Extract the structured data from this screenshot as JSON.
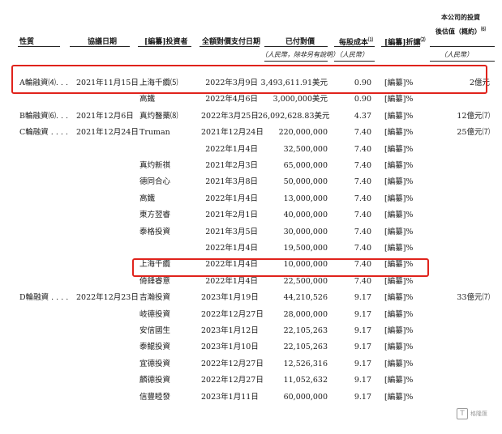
{
  "headers": {
    "nature": "性質",
    "agreement_date": "協議日期",
    "investor": "[編纂]投資者",
    "payment_date": "全額對價支付日期",
    "consideration": "已付對價",
    "consideration_unit": "（人民幣，除非另有說明）",
    "cost_per_share": "每股成本",
    "cost_per_share_note": "⑴",
    "cost_per_share_unit": "（人民幣）",
    "discount": "[編纂]折讓",
    "discount_note": "⑵",
    "post_value_line1": "本公司的投資",
    "post_value_line2": "後估值（概約）",
    "post_value_note": "⑹",
    "post_value_unit": "（人民幣）"
  },
  "rows": [
    {
      "nature": "A輪融資⑷. . .",
      "agreement_date": "2021年11月15日",
      "investor": "上海千纜⑸",
      "payment_date": "2022年3月9日",
      "consideration": "3,493,611.91美元",
      "cost": "0.90",
      "discount": "[編纂]%",
      "valuation": "2億元"
    },
    {
      "nature": "",
      "agreement_date": "",
      "investor": "高鐵",
      "payment_date": "2022年4月6日",
      "consideration": "3,000,000美元",
      "cost": "0.90",
      "discount": "[編纂]%",
      "valuation": ""
    },
    {
      "nature": "B輪融資⑹. . .",
      "agreement_date": "2021年12月6日",
      "investor": "真灼醫藥⑻",
      "payment_date": "2022年3月25日",
      "consideration": "26,092,628.83美元",
      "cost": "4.37",
      "discount": "[編纂]%",
      "valuation": "12億元⑺"
    },
    {
      "nature": "C輪融資 . . . .",
      "agreement_date": "2021年12月24日",
      "investor": "Truman",
      "payment_date": "2021年12月24日",
      "consideration": "220,000,000",
      "cost": "7.40",
      "discount": "[編纂]%",
      "valuation": "25億元⑺"
    },
    {
      "nature": "",
      "agreement_date": "",
      "investor": "",
      "payment_date": "2022年1月4日",
      "consideration": "32,500,000",
      "cost": "7.40",
      "discount": "[編纂]%",
      "valuation": ""
    },
    {
      "nature": "",
      "agreement_date": "",
      "investor": "真灼新祺",
      "payment_date": "2021年2月3日",
      "consideration": "65,000,000",
      "cost": "7.40",
      "discount": "[編纂]%",
      "valuation": ""
    },
    {
      "nature": "",
      "agreement_date": "",
      "investor": "德同合心",
      "payment_date": "2021年3月8日",
      "consideration": "50,000,000",
      "cost": "7.40",
      "discount": "[編纂]%",
      "valuation": ""
    },
    {
      "nature": "",
      "agreement_date": "",
      "investor": "高鐵",
      "payment_date": "2022年1月4日",
      "consideration": "13,000,000",
      "cost": "7.40",
      "discount": "[編纂]%",
      "valuation": ""
    },
    {
      "nature": "",
      "agreement_date": "",
      "investor": "東方翌睿",
      "payment_date": "2021年2月1日",
      "consideration": "40,000,000",
      "cost": "7.40",
      "discount": "[編纂]%",
      "valuation": ""
    },
    {
      "nature": "",
      "agreement_date": "",
      "investor": "泰格投資",
      "payment_date": "2021年3月5日",
      "consideration": "30,000,000",
      "cost": "7.40",
      "discount": "[編纂]%",
      "valuation": ""
    },
    {
      "nature": "",
      "agreement_date": "",
      "investor": "",
      "payment_date": "2022年1月4日",
      "consideration": "19,500,000",
      "cost": "7.40",
      "discount": "[編纂]%",
      "valuation": ""
    },
    {
      "nature": "",
      "agreement_date": "",
      "investor": "上海千纜",
      "payment_date": "2022年1月4日",
      "consideration": "10,000,000",
      "cost": "7.40",
      "discount": "[編纂]%",
      "valuation": ""
    },
    {
      "nature": "",
      "agreement_date": "",
      "investor": "倚鋒睿意",
      "payment_date": "2022年1月4日",
      "consideration": "22,500,000",
      "cost": "7.40",
      "discount": "[編纂]%",
      "valuation": ""
    },
    {
      "nature": "D輪融資 . . . .",
      "agreement_date": "2022年12月23日",
      "investor": "吉瀚投資",
      "payment_date": "2023年1月19日",
      "consideration": "44,210,526",
      "cost": "9.17",
      "discount": "[編纂]%",
      "valuation": "33億元⑺"
    },
    {
      "nature": "",
      "agreement_date": "",
      "investor": "岐德投資",
      "payment_date": "2022年12月27日",
      "consideration": "28,000,000",
      "cost": "9.17",
      "discount": "[編纂]%",
      "valuation": ""
    },
    {
      "nature": "",
      "agreement_date": "",
      "investor": "安信國生",
      "payment_date": "2023年1月12日",
      "consideration": "22,105,263",
      "cost": "9.17",
      "discount": "[編纂]%",
      "valuation": ""
    },
    {
      "nature": "",
      "agreement_date": "",
      "investor": "泰鯤投資",
      "payment_date": "2023年1月10日",
      "consideration": "22,105,263",
      "cost": "9.17",
      "discount": "[編纂]%",
      "valuation": ""
    },
    {
      "nature": "",
      "agreement_date": "",
      "investor": "宜德投資",
      "payment_date": "2022年12月27日",
      "consideration": "12,526,316",
      "cost": "9.17",
      "discount": "[編纂]%",
      "valuation": ""
    },
    {
      "nature": "",
      "agreement_date": "",
      "investor": "麟德投資",
      "payment_date": "2022年12月27日",
      "consideration": "11,052,632",
      "cost": "9.17",
      "discount": "[編纂]%",
      "valuation": ""
    },
    {
      "nature": "",
      "agreement_date": "",
      "investor": "信豐睦發",
      "payment_date": "2023年1月11日",
      "consideration": "60,000,000",
      "cost": "9.17",
      "discount": "[編纂]%",
      "valuation": ""
    }
  ],
  "watermark": {
    "icon": "logo-icon",
    "text": "格隆匯"
  },
  "colors": {
    "highlight": "#e0231c",
    "text": "#1a1a1a"
  }
}
